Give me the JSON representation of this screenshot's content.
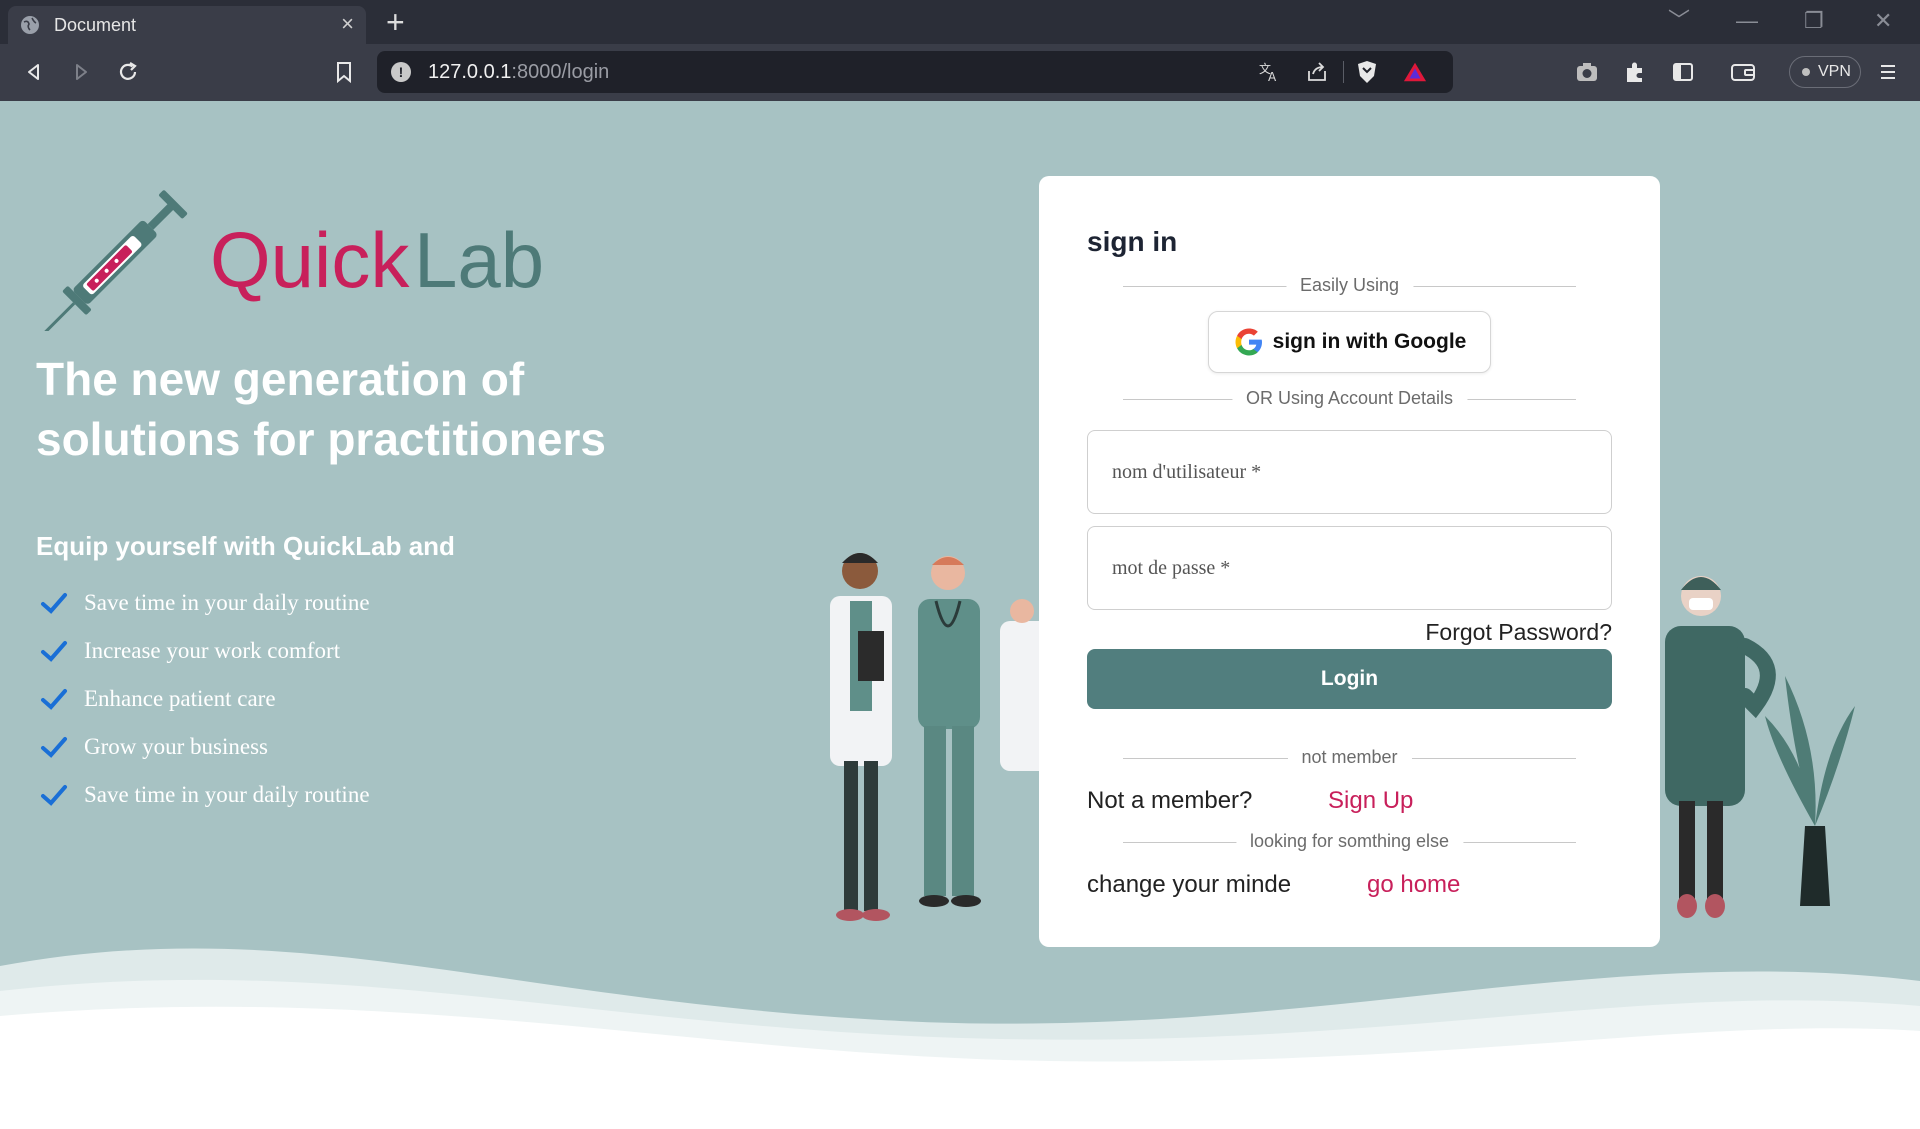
{
  "browser": {
    "tab_title": "Document",
    "tab_close": "×",
    "new_tab": "+",
    "url_host": "127.0.0.1",
    "url_path": ":8000/login",
    "vpn_label": "VPN",
    "window_controls": [
      "﹀",
      "—",
      "❐",
      "✕"
    ]
  },
  "brand": {
    "quick": "Quick",
    "lab": "Lab",
    "accent": "#c8205b",
    "secondary": "#4e7a78"
  },
  "hero": {
    "title_line1": "The new generation of",
    "title_line2": "solutions for practitioners",
    "subtitle": "Equip yourself with QuickLab and",
    "features": [
      "Save time in your daily routine",
      "Increase your work comfort",
      "Enhance patient care",
      "Grow your business",
      "Save time in your daily routine"
    ]
  },
  "login": {
    "title": "sign in",
    "easily_using": "Easily Using",
    "google_label": "sign in with Google",
    "or_account": "OR Using Account Details",
    "username_placeholder": "nom d'utilisateur *",
    "password_placeholder": "mot de passe *",
    "forgot": "Forgot Password?",
    "login_button": "Login",
    "not_member_divider": "not member",
    "not_member_text": "Not a member?",
    "sign_up": "Sign Up",
    "looking_divider": "looking for somthing else",
    "change_text": "change your minde",
    "go_home": "go home"
  },
  "colors": {
    "page_bg": "#a7c2c3",
    "button": "#517e7e",
    "link": "#c8205b"
  }
}
